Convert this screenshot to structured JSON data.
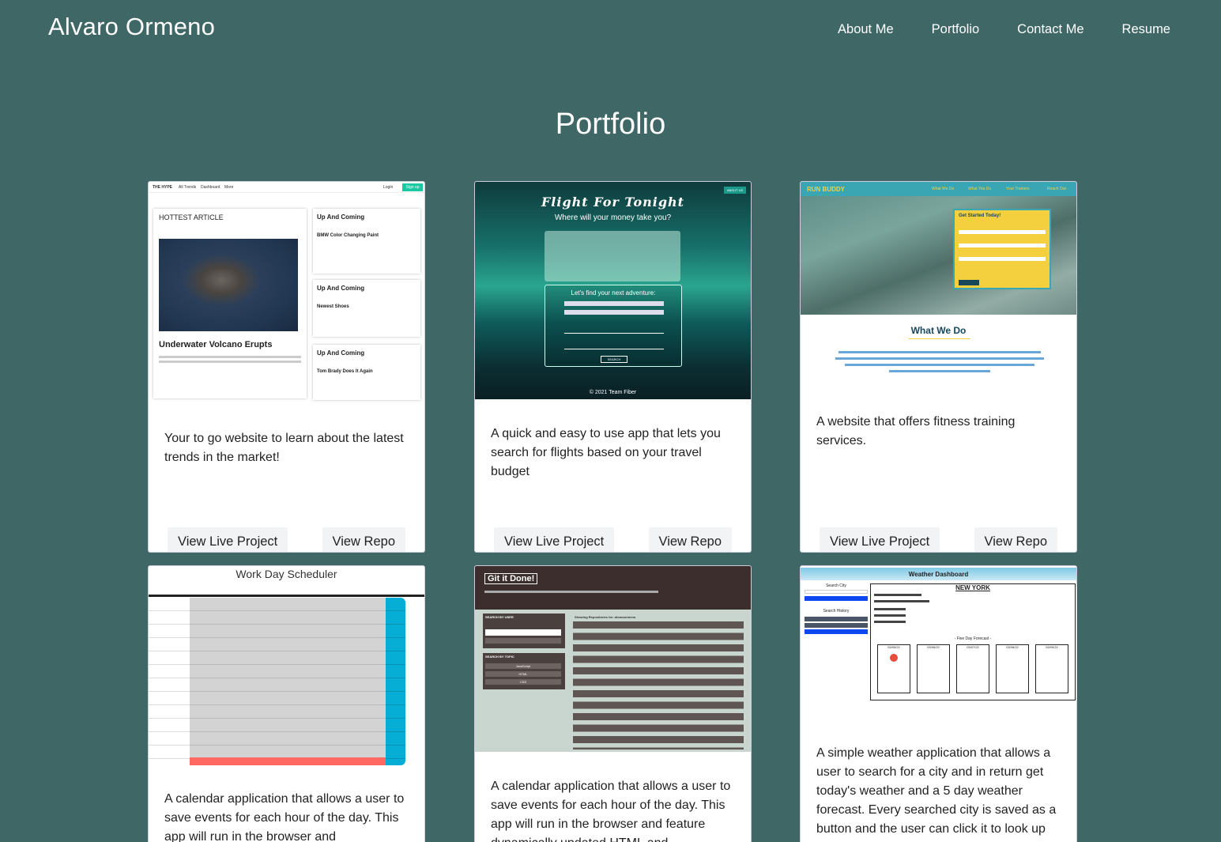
{
  "header": {
    "brand": "Alvaro Ormeno",
    "nav": [
      "About Me",
      "Portfolio",
      "Contact Me",
      "Resume"
    ]
  },
  "page_title": "Portfolio",
  "buttons": {
    "live": "View Live Project",
    "repo": "View Repo"
  },
  "projects": [
    {
      "description": "Your to go website to learn about the latest trends in the market!",
      "thumb": {
        "brand": "THE HYPE",
        "links": [
          "All Trends",
          "Dashboard",
          "More"
        ],
        "login": "Login",
        "signup": "Sign up",
        "hottest": "HOTTEST ARTICLE",
        "headline": "Underwater Volcano Erupts",
        "side": [
          {
            "heading": "Up And Coming",
            "title": "BMW Color Changing Paint"
          },
          {
            "heading": "Up And Coming",
            "title": "Newest Shoes"
          },
          {
            "heading": "Up And Coming",
            "title": "Tom Brady Does It Again"
          }
        ]
      }
    },
    {
      "description": "A quick and easy to use app that lets you search for flights based on your travel budget",
      "thumb": {
        "title": "Flight For Tonight",
        "subtitle": "Where will your money take you?",
        "panel": "Let's find your next adventure:",
        "about": "ABOUT US",
        "search": "SEARCH",
        "footer": "© 2021 Team Fiber"
      }
    },
    {
      "description": "A website that offers fitness training services.",
      "thumb": {
        "brand": "RUN BUDDY",
        "links": [
          "What We Do",
          "What You Do",
          "Your Trainers",
          "Reach Out"
        ],
        "form_title": "Get Started Today!",
        "section": "What We Do"
      }
    },
    {
      "description": "A calendar application that allows a user to save events for each hour of the day. This app will run in the browser and",
      "thumb": {
        "title": "Work Day Scheduler"
      }
    },
    {
      "description": "A calendar application that allows a user to save events for each hour of the day. This app will run in the browser and feature dynamically updated HTML and",
      "thumb": {
        "title": "Git it Done!",
        "search_user": "SEARCH BY USER",
        "search_topic": "SEARCH BY TOPIC",
        "repos": "Showing Repositories for: alvaroormeno",
        "topics": [
          "JavaScript",
          "HTML",
          "CSS"
        ]
      }
    },
    {
      "description": "A simple weather application that allows a user to search for a city and in return get today's weather and a 5 day weather forecast. Every searched city is saved as a button and the user can click it to look up",
      "thumb": {
        "title": "Weather Dashboard",
        "search_city": "Search City",
        "history": "Search History",
        "city": "NEW YORK",
        "forecast_label": "- Five Day Forecast -",
        "forecast": [
          "03/05/22",
          "03/06/22",
          "03/07/22",
          "03/08/22",
          "03/09/22"
        ]
      }
    }
  ]
}
